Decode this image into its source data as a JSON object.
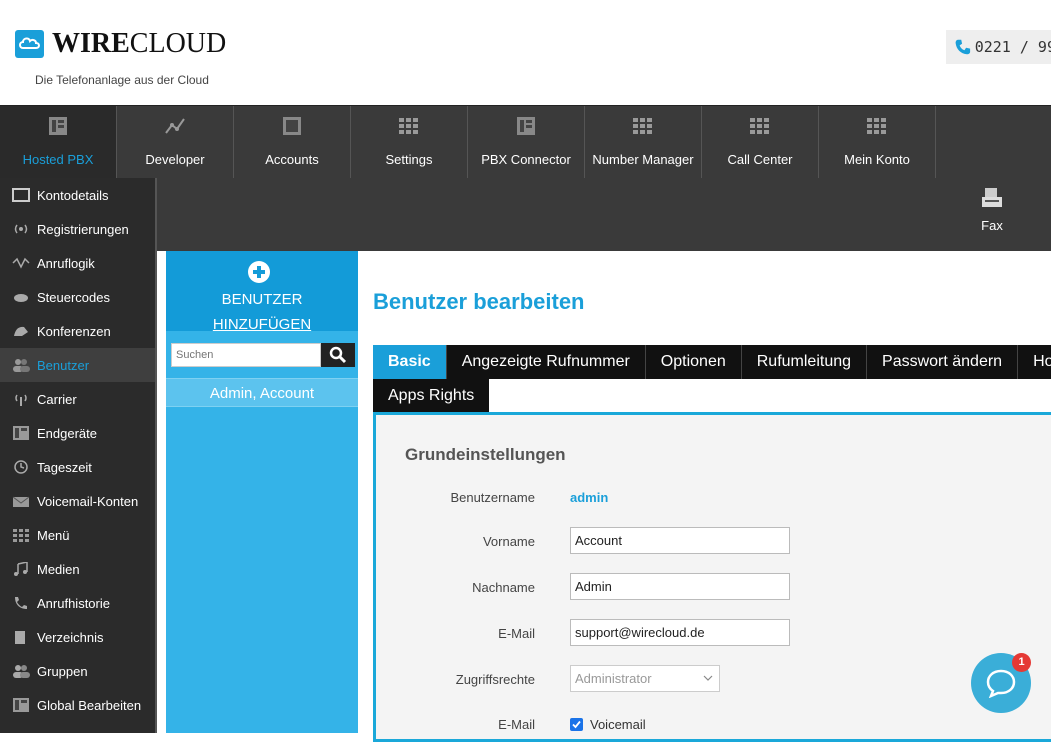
{
  "header": {
    "logo_bold": "WIRE",
    "logo_regular": "CLOUD",
    "tagline": "Die Telefonanlage aus der Cloud",
    "phone": "0221 / 99"
  },
  "topnav": {
    "items": [
      {
        "label": "Hosted PBX",
        "icon": "building-icon"
      },
      {
        "label": "Developer",
        "icon": "chart-icon"
      },
      {
        "label": "Accounts",
        "icon": "accounts-icon"
      },
      {
        "label": "Settings",
        "icon": "grid-icon"
      },
      {
        "label": "PBX Connector",
        "icon": "building-icon"
      },
      {
        "label": "Number Manager",
        "icon": "grid-icon"
      },
      {
        "label": "Call Center",
        "icon": "grid-icon"
      },
      {
        "label": "Mein Konto",
        "icon": "grid-icon"
      }
    ]
  },
  "secondbar": {
    "fax_label": "Fax"
  },
  "sidebar": {
    "items": [
      {
        "label": "Kontodetails"
      },
      {
        "label": "Registrierungen"
      },
      {
        "label": "Anruflogik"
      },
      {
        "label": "Steuercodes"
      },
      {
        "label": "Konferenzen"
      },
      {
        "label": "Benutzer"
      },
      {
        "label": "Carrier"
      },
      {
        "label": "Endgeräte"
      },
      {
        "label": "Tageszeit"
      },
      {
        "label": "Voicemail-Konten"
      },
      {
        "label": "Menü"
      },
      {
        "label": "Medien"
      },
      {
        "label": "Anrufhistorie"
      },
      {
        "label": "Verzeichnis"
      },
      {
        "label": "Gruppen"
      },
      {
        "label": "Global Bearbeiten"
      }
    ]
  },
  "userpanel": {
    "add_line1": "BENUTZER",
    "add_line2": "HINZUFÜGEN",
    "search_placeholder": "Suchen",
    "user_name": "Admin, Account"
  },
  "main": {
    "title": "Benutzer bearbeiten",
    "tabs": [
      "Basic",
      "Angezeigte Rufnummer",
      "Optionen",
      "Rufumleitung",
      "Passwort ändern",
      "Ho"
    ],
    "tab_row2": "Apps Rights",
    "section_title": "Grundeinstellungen",
    "fields": {
      "username_label": "Benutzername",
      "username_value": "admin",
      "firstname_label": "Vorname",
      "firstname_value": "Account",
      "lastname_label": "Nachname",
      "lastname_value": "Admin",
      "email_label": "E-Mail",
      "email_value": "support@wirecloud.de",
      "access_label": "Zugriffsrechte",
      "access_value": "Administrator",
      "email2_label": "E-Mail",
      "voicemail_label": "Voicemail"
    }
  },
  "chat": {
    "badge": "1"
  }
}
